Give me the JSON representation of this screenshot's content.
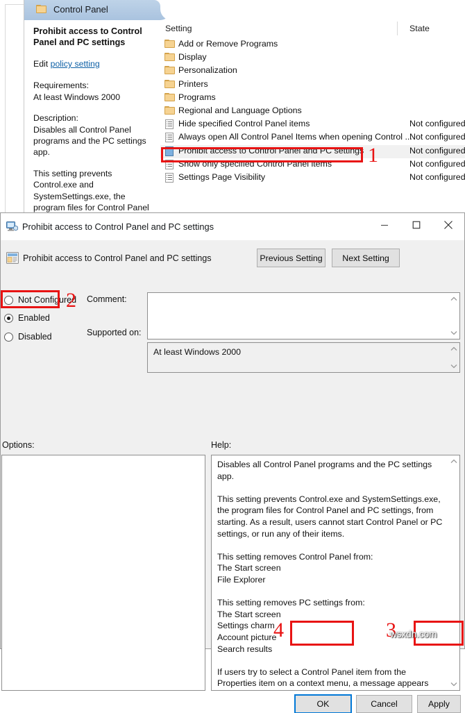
{
  "gpedit": {
    "tab_label": "Control Panel",
    "description": {
      "title": "Prohibit access to Control Panel and PC settings",
      "edit_prefix": "Edit ",
      "edit_link": "policy setting",
      "requirements_label": "Requirements:",
      "requirements_value": "At least Windows 2000",
      "description_label": "Description:",
      "description_p1": "Disables all Control Panel programs and the PC settings app.",
      "description_p2": "This setting prevents Control.exe and SystemSettings.exe, the program files for Control Panel and PC settings, from starting. As a result, users cannot start Control"
    },
    "columns": {
      "setting": "Setting",
      "state": "State"
    },
    "rows": [
      {
        "icon": "folder-icon",
        "name": "Add or Remove Programs",
        "state": "",
        "type": "folder",
        "selected": false
      },
      {
        "icon": "folder-icon",
        "name": "Display",
        "state": "",
        "type": "folder",
        "selected": false
      },
      {
        "icon": "folder-icon",
        "name": "Personalization",
        "state": "",
        "type": "folder",
        "selected": false
      },
      {
        "icon": "folder-icon",
        "name": "Printers",
        "state": "",
        "type": "folder",
        "selected": false
      },
      {
        "icon": "folder-icon",
        "name": "Programs",
        "state": "",
        "type": "folder",
        "selected": false
      },
      {
        "icon": "folder-icon",
        "name": "Regional and Language Options",
        "state": "",
        "type": "folder",
        "selected": false
      },
      {
        "icon": "policy-icon",
        "name": "Hide specified Control Panel items",
        "state": "Not configured",
        "type": "policy",
        "selected": false
      },
      {
        "icon": "policy-icon",
        "name": "Always open All Control Panel Items when opening Control ...",
        "state": "Not configured",
        "type": "policy",
        "selected": false
      },
      {
        "icon": "policy-configured-icon",
        "name": "Prohibit access to Control Panel and PC settings",
        "state": "Not configured",
        "type": "policy-blue",
        "selected": true
      },
      {
        "icon": "policy-icon",
        "name": "Show only specified Control Panel items",
        "state": "Not configured",
        "type": "policy",
        "selected": false
      },
      {
        "icon": "policy-icon",
        "name": "Settings Page Visibility",
        "state": "Not configured",
        "type": "policy",
        "selected": false
      }
    ]
  },
  "dialog": {
    "title": "Prohibit access to Control Panel and PC settings",
    "setting_title": "Prohibit access to Control Panel and PC settings",
    "previous_setting": "Previous Setting",
    "next_setting": "Next Setting",
    "radios": {
      "not_configured": "Not Configured",
      "enabled": "Enabled",
      "disabled": "Disabled",
      "selected": "Enabled"
    },
    "comment_label": "Comment:",
    "comment_value": "",
    "supported_label": "Supported on:",
    "supported_value": "At least Windows 2000",
    "options_label": "Options:",
    "options_value": "",
    "help_label": "Help:",
    "help_text": "Disables all Control Panel programs and the PC settings app.\n\nThis setting prevents Control.exe and SystemSettings.exe, the program files for Control Panel and PC settings, from starting. As a result, users cannot start Control Panel or PC settings, or run any of their items.\n\nThis setting removes Control Panel from:\nThe Start screen\nFile Explorer\n\nThis setting removes PC settings from:\nThe Start screen\nSettings charm\nAccount picture\nSearch results\n\nIf users try to select a Control Panel item from the Properties item on a context menu, a message appears explaining that a setting prevents the action.",
    "buttons": {
      "ok": "OK",
      "cancel": "Cancel",
      "apply": "Apply"
    },
    "window_controls": {
      "minimize": "—",
      "maximize": "□",
      "close": "✕"
    }
  },
  "annotations": {
    "step1": "1",
    "step2": "2",
    "step3": "3",
    "step4": "4",
    "accent_color": "#e81313"
  },
  "watermark": "wsxdn.com"
}
